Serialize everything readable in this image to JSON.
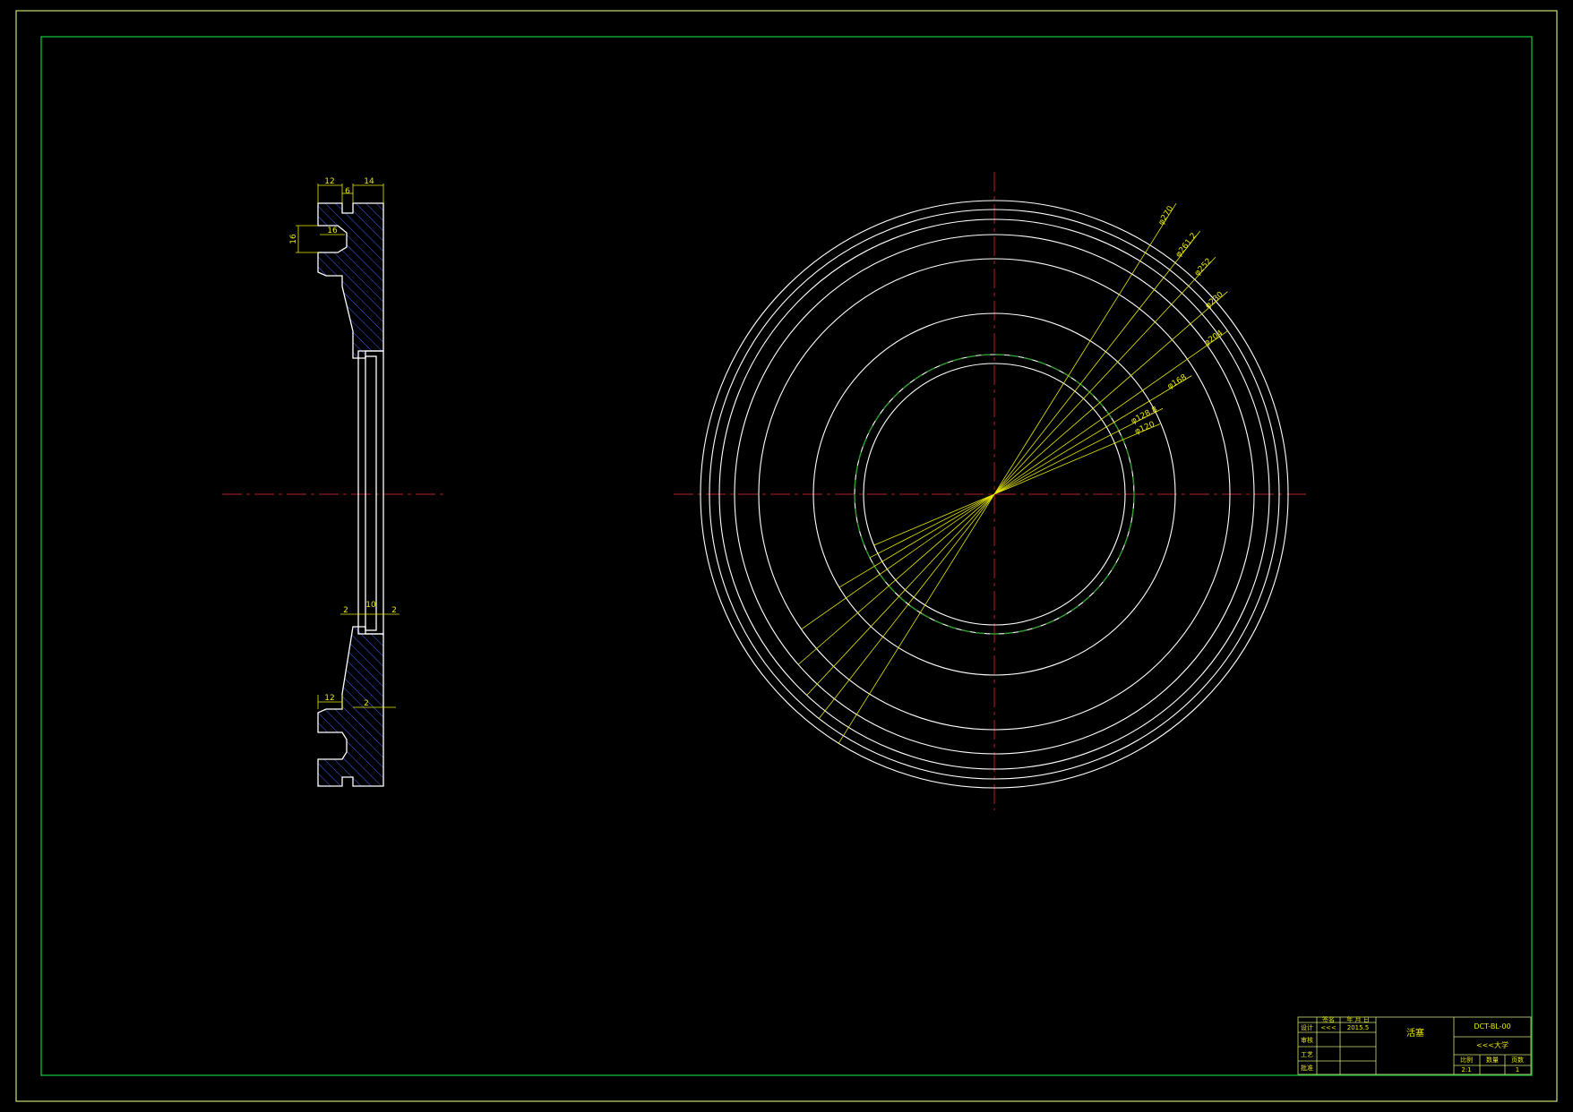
{
  "colors": {
    "background": "#000000",
    "frame": "#c8e070",
    "geometry": "#ffffff",
    "dimension": "#e8e800",
    "centerline": "#b02020",
    "hatch": "#4060ff",
    "dashed_circle": "#2a9a2a"
  },
  "section_view": {
    "dims": {
      "top_12": "12",
      "top_6": "6",
      "top_14": "14",
      "slot_16_h": "16",
      "slot_16_v": "16",
      "mid_2_left": "2",
      "mid_10": "10",
      "mid_2_right": "2",
      "bot_12": "12",
      "bot_2": "2"
    }
  },
  "plan_view": {
    "diameter_labels": [
      "φ270",
      "φ261.2",
      "φ252",
      "φ230",
      "φ204",
      "φ168",
      "φ128.8",
      "φ120"
    ]
  },
  "title_block": {
    "header": {
      "sign": "签名",
      "date": "年 月 日"
    },
    "rows": [
      {
        "label": "设计",
        "sign": "<<<",
        "date": "2015.5"
      },
      {
        "label": "审核",
        "sign": "",
        "date": ""
      },
      {
        "label": "工艺",
        "sign": "",
        "date": ""
      },
      {
        "label": "批准",
        "sign": "",
        "date": ""
      }
    ],
    "part_name": "活塞",
    "drawing_no": "DCT-BL-00",
    "school": "<<<大学",
    "ratio_label": "比例",
    "qty_label": "数量",
    "sheet_label": "页数",
    "ratio_value": "2:1",
    "qty_value": "",
    "sheet_value": "1"
  }
}
